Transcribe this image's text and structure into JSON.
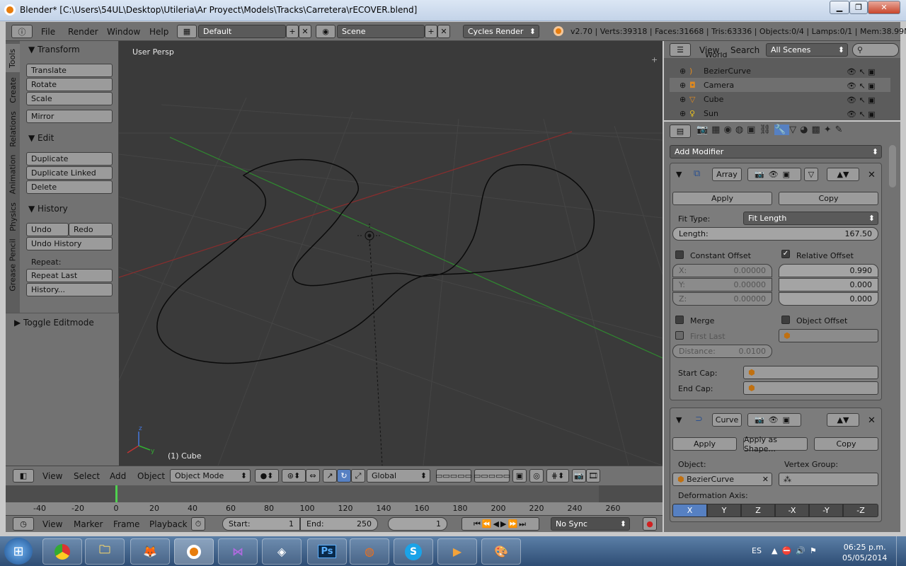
{
  "window": {
    "title": "Blender* [C:\\Users\\54UL\\Desktop\\Utileria\\Ar Proyect\\Models\\Tracks\\Carretera\\rECOVER.blend]"
  },
  "info_header": {
    "menus": [
      "File",
      "Render",
      "Window",
      "Help"
    ],
    "layout": "Default",
    "scene": "Scene",
    "engine": "Cycles Render",
    "stats": "v2.70 | Verts:39318 | Faces:31668 | Tris:63336 | Objects:0/4 | Lamps:0/1 | Mem:38.99M | C"
  },
  "tool_shelf": {
    "tabs": [
      "Tools",
      "Create",
      "Relations",
      "Animation",
      "Physics",
      "Grease Pencil"
    ],
    "transform": {
      "title": "Transform",
      "translate": "Translate",
      "rotate": "Rotate",
      "scale": "Scale",
      "mirror": "Mirror"
    },
    "edit": {
      "title": "Edit",
      "duplicate": "Duplicate",
      "duplicate_linked": "Duplicate Linked",
      "delete": "Delete"
    },
    "history": {
      "title": "History",
      "undo": "Undo",
      "redo": "Redo",
      "undo_history": "Undo History",
      "repeat_label": "Repeat:",
      "repeat_last": "Repeat Last",
      "history_btn": "History..."
    },
    "toggle_editmode": "Toggle Editmode"
  },
  "viewport": {
    "view_label": "User Persp",
    "object_label": "(1) Cube"
  },
  "view3d_header": {
    "menus": [
      "View",
      "Select",
      "Add",
      "Object"
    ],
    "mode": "Object Mode",
    "orientation": "Global"
  },
  "timeline": {
    "ticks": [
      "-40",
      "-20",
      "0",
      "20",
      "40",
      "60",
      "80",
      "100",
      "120",
      "140",
      "160",
      "180",
      "200",
      "220",
      "240",
      "260"
    ],
    "current_frame_value": 0,
    "menus": [
      "View",
      "Marker",
      "Frame",
      "Playback"
    ],
    "start_label": "Start:",
    "start": "1",
    "end_label": "End:",
    "end": "250",
    "current": "1",
    "sync": "No Sync"
  },
  "outliner": {
    "menus": [
      "View",
      "Search"
    ],
    "filter": "All Scenes",
    "rows": [
      {
        "name": "World"
      },
      {
        "name": "BezierCurve"
      },
      {
        "name": "Camera"
      },
      {
        "name": "Cube"
      },
      {
        "name": "Sun"
      }
    ]
  },
  "properties": {
    "add_modifier": "Add Modifier",
    "array": {
      "name": "Array",
      "apply": "Apply",
      "copy": "Copy",
      "fit_type_label": "Fit Type:",
      "fit_type": "Fit Length",
      "length_label": "Length:",
      "length": "167.50",
      "constant_offset": "Constant Offset",
      "relative_offset": "Relative Offset",
      "const_x_label": "X:",
      "const_x": "0.00000",
      "const_y_label": "Y:",
      "const_y": "0.00000",
      "const_z_label": "Z:",
      "const_z": "0.00000",
      "rel_x": "0.990",
      "rel_y": "0.000",
      "rel_z": "0.000",
      "merge": "Merge",
      "object_offset": "Object Offset",
      "first_last": "First Last",
      "distance_label": "Distance:",
      "distance": "0.0100",
      "start_cap": "Start Cap:",
      "end_cap": "End Cap:"
    },
    "curve": {
      "name": "Curve",
      "apply": "Apply",
      "apply_shape": "Apply as Shape...",
      "copy": "Copy",
      "object_label": "Object:",
      "object": "BezierCurve",
      "vertex_group_label": "Vertex Group:",
      "deformation_axis_label": "Deformation Axis:",
      "axes": [
        "X",
        "Y",
        "Z",
        "-X",
        "-Y",
        "-Z"
      ],
      "active_axis": "X"
    }
  },
  "taskbar": {
    "language": "ES",
    "time": "06:25 p.m.",
    "date": "05/05/2014",
    "apps": [
      "chrome",
      "explorer",
      "gimp",
      "blender",
      "visual-studio",
      "unity",
      "Ps",
      "origin",
      "skype",
      "media",
      "paint"
    ]
  },
  "colors": {
    "accent": "#5680c2",
    "viewport_bg": "#3a3a3a",
    "x_axis": "#b03030",
    "y_axis": "#2f9a2f"
  }
}
